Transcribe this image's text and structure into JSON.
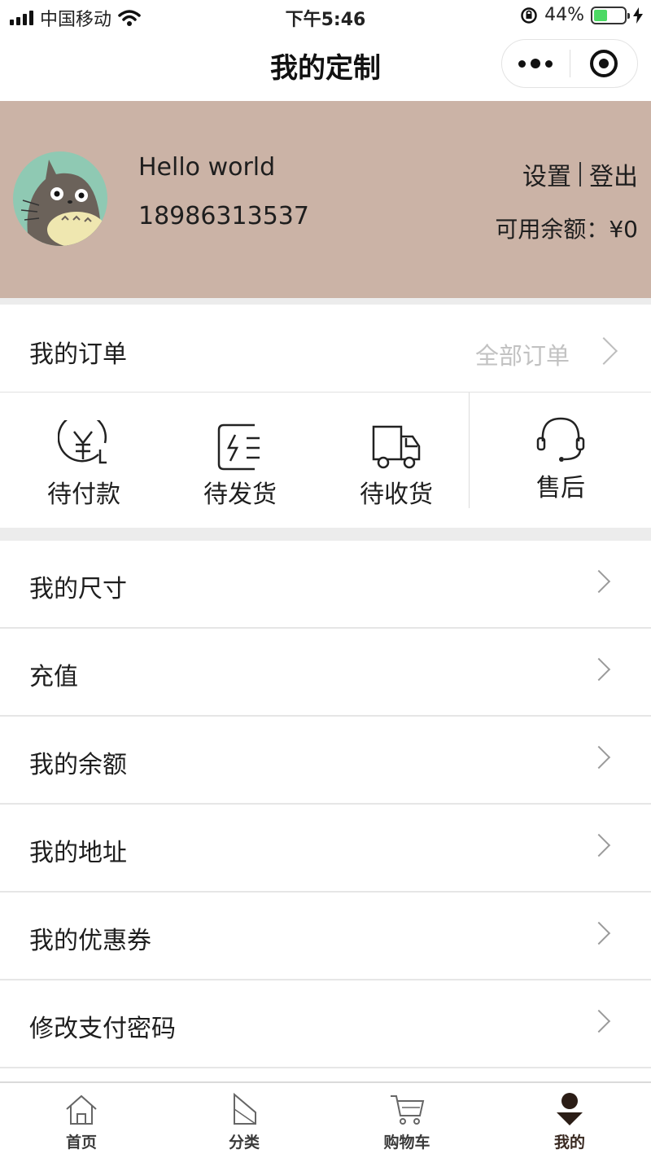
{
  "status_bar": {
    "carrier": "中国移动",
    "time": "下午5:46",
    "battery": "44%",
    "battery_level": 0.44
  },
  "nav": {
    "title": "我的定制"
  },
  "profile": {
    "name": "Hello world",
    "phone": "18986313537",
    "settings_label": "设置",
    "logout_label": "登出",
    "balance_text": "可用余额：¥0",
    "bg_color": "#cbb3a6"
  },
  "orders": {
    "title": "我的订单",
    "all_label": "全部订单",
    "statuses": [
      {
        "label": "待付款",
        "icon": "yuan-clock-icon"
      },
      {
        "label": "待发货",
        "icon": "shipment-icon"
      },
      {
        "label": "待收货",
        "icon": "truck-icon"
      },
      {
        "label": "售后",
        "icon": "headset-icon"
      }
    ]
  },
  "menu": [
    {
      "label": "我的尺寸"
    },
    {
      "label": "充值"
    },
    {
      "label": "我的余额"
    },
    {
      "label": "我的地址"
    },
    {
      "label": "我的优惠券"
    },
    {
      "label": "修改支付密码"
    }
  ],
  "tabbar": [
    {
      "label": "首页",
      "icon": "home-icon",
      "active": false
    },
    {
      "label": "分类",
      "icon": "category-icon",
      "active": false
    },
    {
      "label": "购物车",
      "icon": "cart-icon",
      "active": false
    },
    {
      "label": "我的",
      "icon": "profile-icon",
      "active": true
    }
  ]
}
